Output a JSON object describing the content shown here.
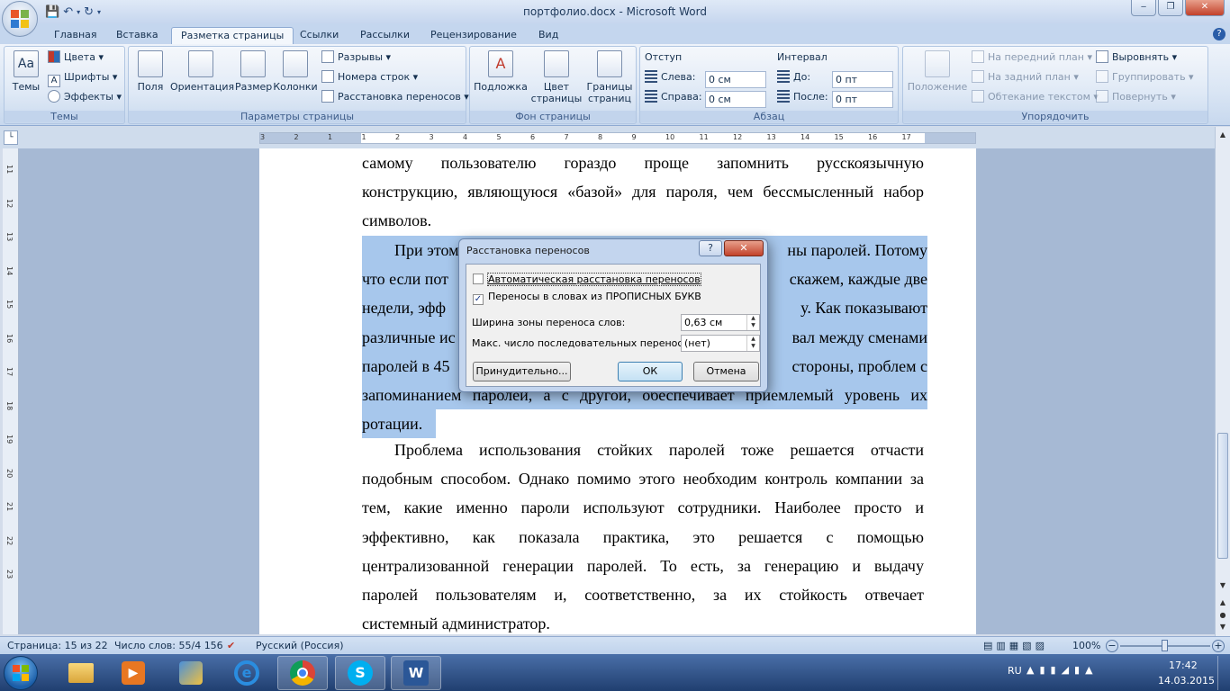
{
  "window": {
    "title": "портфолио.docx - Microsoft Word"
  },
  "tabs": [
    "Главная",
    "Вставка",
    "Разметка страницы",
    "Ссылки",
    "Рассылки",
    "Рецензирование",
    "Вид"
  ],
  "ribbon": {
    "themes": {
      "label": "Темы",
      "big": "Темы",
      "colors": "Цвета",
      "fonts": "Шрифты",
      "effects": "Эффекты"
    },
    "page_setup": {
      "label": "Параметры страницы",
      "margins": "Поля",
      "orientation": "Ориентация",
      "size": "Размер",
      "columns": "Колонки",
      "breaks": "Разрывы",
      "line_numbers": "Номера строк",
      "hyphenation": "Расстановка переносов"
    },
    "page_bg": {
      "label": "Фон страницы",
      "watermark": "Подложка",
      "page_color_1": "Цвет",
      "page_color_2": "страницы",
      "borders_1": "Границы",
      "borders_2": "страниц"
    },
    "paragraph": {
      "label": "Абзац",
      "indent": "Отступ",
      "left": "Слева:",
      "left_val": "0 см",
      "right": "Справа:",
      "right_val": "0 см",
      "spacing": "Интервал",
      "before": "До:",
      "before_val": "0 пт",
      "after": "После:",
      "after_val": "0 пт"
    },
    "arrange": {
      "label": "Упорядочить",
      "position": "Положение",
      "front": "На передний план",
      "back": "На задний план",
      "wrap": "Обтекание текстом",
      "align": "Выровнять",
      "group": "Группировать",
      "rotate": "Повернуть"
    }
  },
  "document": {
    "p1_lines": [
      "самому пользователю гораздо проще запомнить русскоязычную",
      "конструкцию, являющуюся «базой» для пароля, чем бессмысленный набор",
      "символов."
    ],
    "p2_lines": [
      "При этом",
      "ны паролей. Потому",
      "что если пот",
      "скажем, каждые две",
      "недели, эфф",
      "у. Как показывают",
      "различные ис",
      "вал между сменами",
      "паролей в 45",
      "стороны, проблем с",
      "запоминанием паролей, а с другой, обеспечивает приемлемый уровень их",
      "ротации."
    ],
    "p3_lines": [
      "Проблема использования стойких паролей тоже решается отчасти",
      "подобным способом. Однако помимо этого необходим контроль компании за",
      "тем, какие именно пароли используют сотрудники. Наиболее просто и",
      "эффективно, как показала практика, это решается с помощью",
      "централизованной генерации паролей. То есть, за генерацию и выдачу",
      "паролей пользователям и, соответственно, за их стойкость отвечает",
      "системный администратор."
    ]
  },
  "dialog": {
    "title": "Расстановка переносов",
    "help": "?",
    "auto_label": "Автоматическая расстановка переносов",
    "auto_checked": false,
    "caps_label": "Переносы в словах из ПРОПИСНЫХ БУКВ",
    "caps_checked": true,
    "zone_label": "Ширина зоны переноса слов:",
    "zone_value": "0,63 см",
    "max_label": "Макс. число последовательных переносов:",
    "max_value": "(нет)",
    "manual_btn": "Принудительно...",
    "ok_btn": "ОК",
    "cancel_btn": "Отмена"
  },
  "status": {
    "page": "Страница: 15 из 22",
    "words": "Число слов: 55/4 156",
    "lang": "Русский (Россия)",
    "zoom": "100%"
  },
  "tray": {
    "lang": "RU",
    "time": "17:42",
    "date": "14.03.2015"
  },
  "ruler": {
    "h_ticks": [
      "3",
      "2",
      "1",
      "1",
      "2",
      "3",
      "4",
      "5",
      "6",
      "7",
      "8",
      "9",
      "10",
      "11",
      "12",
      "13",
      "14",
      "15",
      "16",
      "17"
    ],
    "v_ticks": [
      "11",
      "12",
      "13",
      "14",
      "15",
      "16",
      "17",
      "18",
      "19",
      "20",
      "21",
      "22",
      "23"
    ]
  },
  "colors": {
    "accent": "#2a5da8",
    "selection": "#a7c7ec"
  }
}
